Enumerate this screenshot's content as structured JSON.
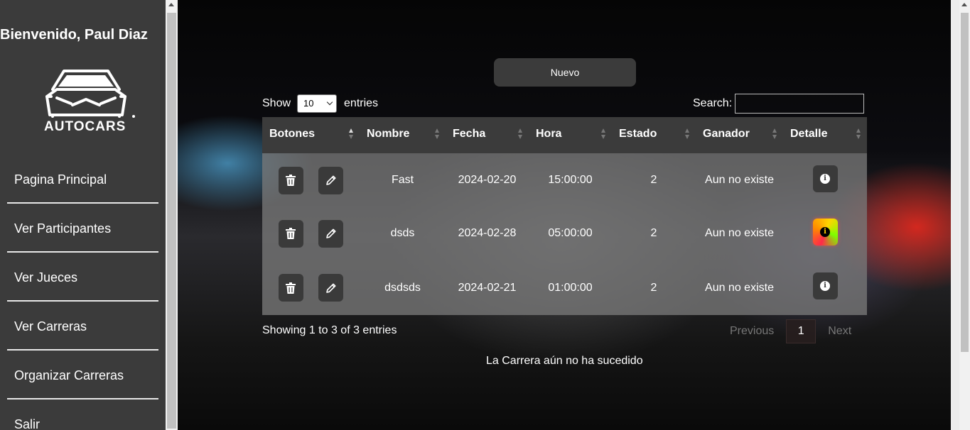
{
  "sidebar": {
    "welcome": "Bienvenido, Paul Diaz",
    "logo_text": "AUTOCARS",
    "items": [
      {
        "label": "Pagina Principal"
      },
      {
        "label": "Ver Participantes"
      },
      {
        "label": "Ver Jueces"
      },
      {
        "label": "Ver Carreras"
      },
      {
        "label": "Organizar Carreras"
      },
      {
        "label": "Salir"
      }
    ]
  },
  "main": {
    "new_button": "Nuevo",
    "length": {
      "show": "Show",
      "value": "10",
      "entries": "entries"
    },
    "search": {
      "label": "Search:",
      "value": ""
    },
    "table": {
      "headers": [
        "Botones",
        "Nombre",
        "Fecha",
        "Hora",
        "Estado",
        "Ganador",
        "Detalle"
      ],
      "rows": [
        {
          "nombre": "Fast",
          "fecha": "2024-02-20",
          "hora": "15:00:00",
          "estado": "2",
          "ganador": "Aun no existe"
        },
        {
          "nombre": "dsds",
          "fecha": "2024-02-28",
          "hora": "05:00:00",
          "estado": "2",
          "ganador": "Aun no existe"
        },
        {
          "nombre": "dsdsds",
          "fecha": "2024-02-21",
          "hora": "01:00:00",
          "estado": "2",
          "ganador": "Aun no existe"
        }
      ]
    },
    "info": "Showing 1 to 3 of 3 entries",
    "pagination": {
      "previous": "Previous",
      "current": "1",
      "next": "Next"
    },
    "status_message": "La Carrera aún no ha sucedido"
  },
  "icons": {
    "delete": "trash-icon",
    "edit": "pencil-icon",
    "detail": "info-icon"
  },
  "colors": {
    "sidebar": "#3b3b3b",
    "header": "#3b3b3b",
    "button": "#3a3a3a"
  }
}
